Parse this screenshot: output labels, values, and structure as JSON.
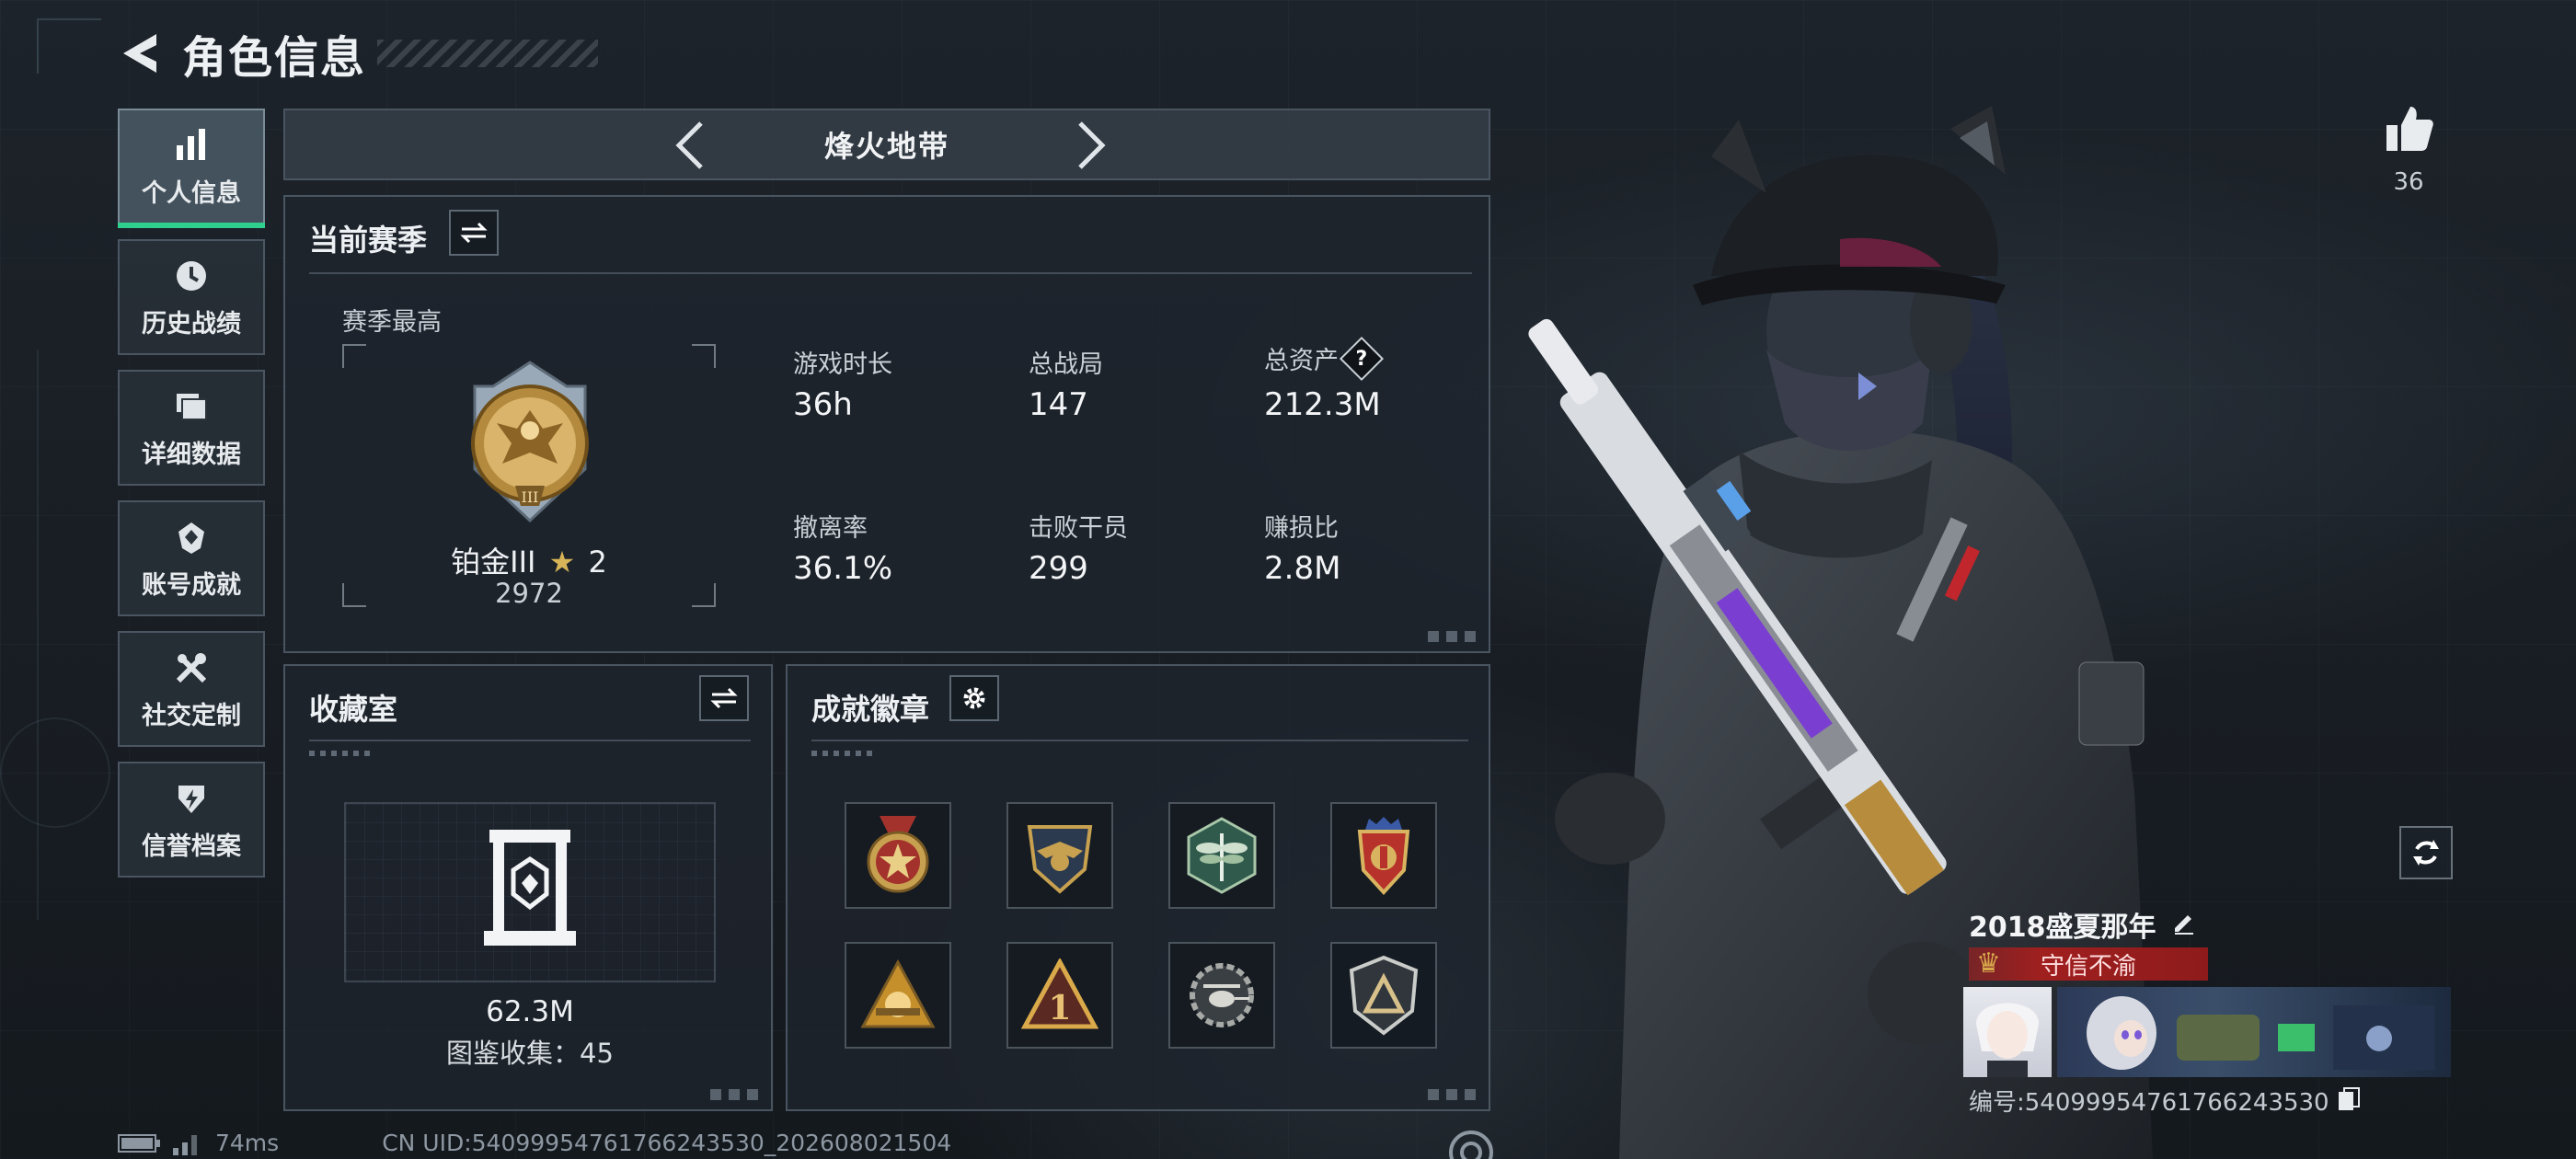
{
  "header": {
    "title": "角色信息"
  },
  "sidebar": {
    "items": [
      {
        "label": "个人信息",
        "icon": "bar-chart-icon",
        "active": true
      },
      {
        "label": "历史战绩",
        "icon": "clock-icon"
      },
      {
        "label": "详细数据",
        "icon": "folder-icon"
      },
      {
        "label": "账号成就",
        "icon": "trophy-icon"
      },
      {
        "label": "社交定制",
        "icon": "tools-icon"
      },
      {
        "label": "信誉档案",
        "icon": "shield-icon"
      }
    ]
  },
  "mode": {
    "name": "烽火地带"
  },
  "season": {
    "title": "当前赛季",
    "best_label": "赛季最高",
    "rank_name": "铂金III",
    "rank_stars": "2",
    "rank_score": "2972",
    "stats": [
      {
        "label": "游戏时长",
        "value": "36h"
      },
      {
        "label": "总战局",
        "value": "147"
      },
      {
        "label": "总资产",
        "value": "212.3M"
      },
      {
        "label": "撤离率",
        "value": "36.1%"
      },
      {
        "label": "击败干员",
        "value": "299"
      },
      {
        "label": "赚损比",
        "value": "2.8M"
      }
    ],
    "help_icon_text": "?"
  },
  "collection": {
    "title": "收藏室",
    "value": "62.3M",
    "count_text": "图鉴收集：45"
  },
  "achievements": {
    "title": "成就徽章",
    "badges": [
      "star-medal-icon",
      "eagle-shield-icon",
      "dragonfly-hex-icon",
      "winged-shield-icon",
      "sunrise-triangle-icon",
      "number-one-triangle-icon",
      "helicopter-gear-icon",
      "arrow-shield-icon"
    ]
  },
  "player": {
    "likes": "36",
    "name": "2018盛夏那年",
    "title_badge": "守信不渝",
    "id_text": "编号:540999547617662435​30"
  },
  "footer": {
    "ping": "74ms",
    "uid": "CN UID:540999547617662435​30_20260802150​4"
  },
  "colors": {
    "accent": "#2fcf8d",
    "title_red": "#a01f1f",
    "panel_bg": "#1e252d"
  }
}
